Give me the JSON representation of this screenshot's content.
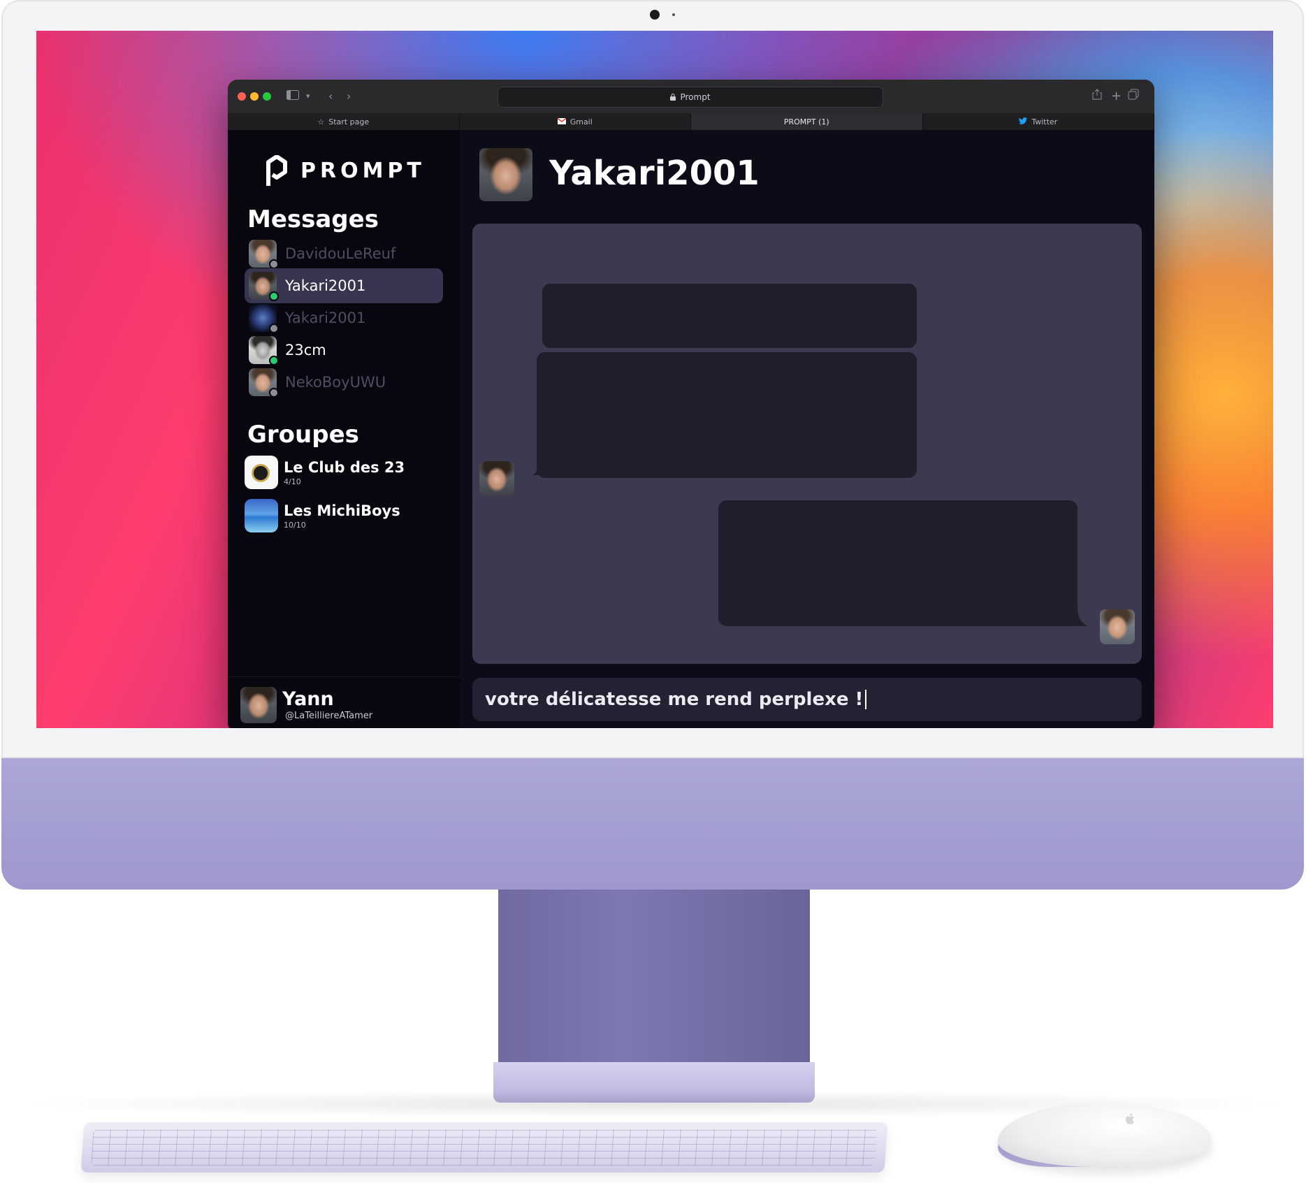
{
  "browser": {
    "address": "Prompt",
    "tabs": [
      {
        "label": "Start page",
        "icon": "star-icon"
      },
      {
        "label": "Gmail",
        "icon": "gmail-icon"
      },
      {
        "label": "PROMPT (1)",
        "icon": "",
        "active": true
      },
      {
        "label": "Twitter",
        "icon": "twitter-icon"
      }
    ]
  },
  "app": {
    "logo_text": "PROMPT",
    "messages_title": "Messages",
    "contacts": [
      {
        "name": "DavidouLeReuf",
        "status_color": "#8e8e99",
        "dim": true
      },
      {
        "name": "Yakari2001",
        "status_color": "#2ecc71",
        "active": true
      },
      {
        "name": "Yakari2001",
        "status_color": "#8e8e99",
        "dim": true
      },
      {
        "name": "23cm",
        "status_color": "#2ecc71"
      },
      {
        "name": "NekoBoyUWU",
        "status_color": "#8e8e99",
        "dim": true
      }
    ],
    "groups_title": "Groupes",
    "groups": [
      {
        "name": "Le Club des 23",
        "count": "4/10"
      },
      {
        "name": "Les MichiBoys",
        "count": "10/10"
      }
    ],
    "me": {
      "name": "Yann",
      "handle": "@LaTeilliereATamer"
    }
  },
  "conversation": {
    "title": "Yakari2001",
    "composer_text": "votre délicatesse me rend perplexe !"
  },
  "colors": {
    "sidebar_bg": "#08070f",
    "chat_bg": "#3b3a51",
    "bubble_bg": "#1f1e2b",
    "online": "#2ecc71",
    "offline": "#8e8e99"
  }
}
